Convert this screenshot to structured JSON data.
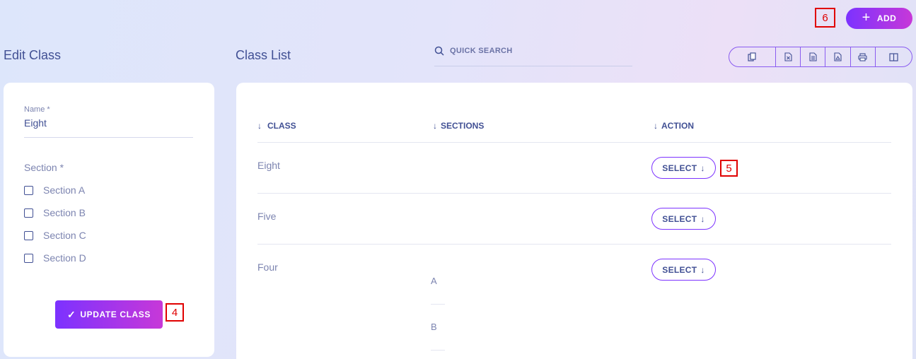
{
  "header": {
    "add_label": "ADD",
    "marker_add": "6"
  },
  "edit_panel": {
    "title": "Edit Class",
    "name_label": "Name *",
    "name_value": "Eight",
    "section_label": "Section *",
    "sections": [
      "Section A",
      "Section B",
      "Section C",
      "Section D"
    ],
    "update_label": "UPDATE CLASS",
    "marker_update": "4"
  },
  "list_panel": {
    "title": "Class List",
    "search_placeholder": "QUICK SEARCH",
    "export_buttons": [
      "copy-icon",
      "excel-icon",
      "csv-icon",
      "pdf-icon",
      "print-icon",
      "columns-icon"
    ],
    "columns": [
      "CLASS",
      "SECTIONS",
      "ACTION"
    ],
    "rows": [
      {
        "class": "Eight",
        "action": "SELECT"
      },
      {
        "class": "Five",
        "action": "SELECT"
      },
      {
        "class": "Four",
        "action": "SELECT",
        "sections": [
          "A",
          "B"
        ]
      }
    ],
    "marker_select": "5"
  },
  "colors": {
    "accent": "#7c32ff",
    "accent2": "#c738d8",
    "text": "#415094",
    "muted": "#7c84b0"
  }
}
